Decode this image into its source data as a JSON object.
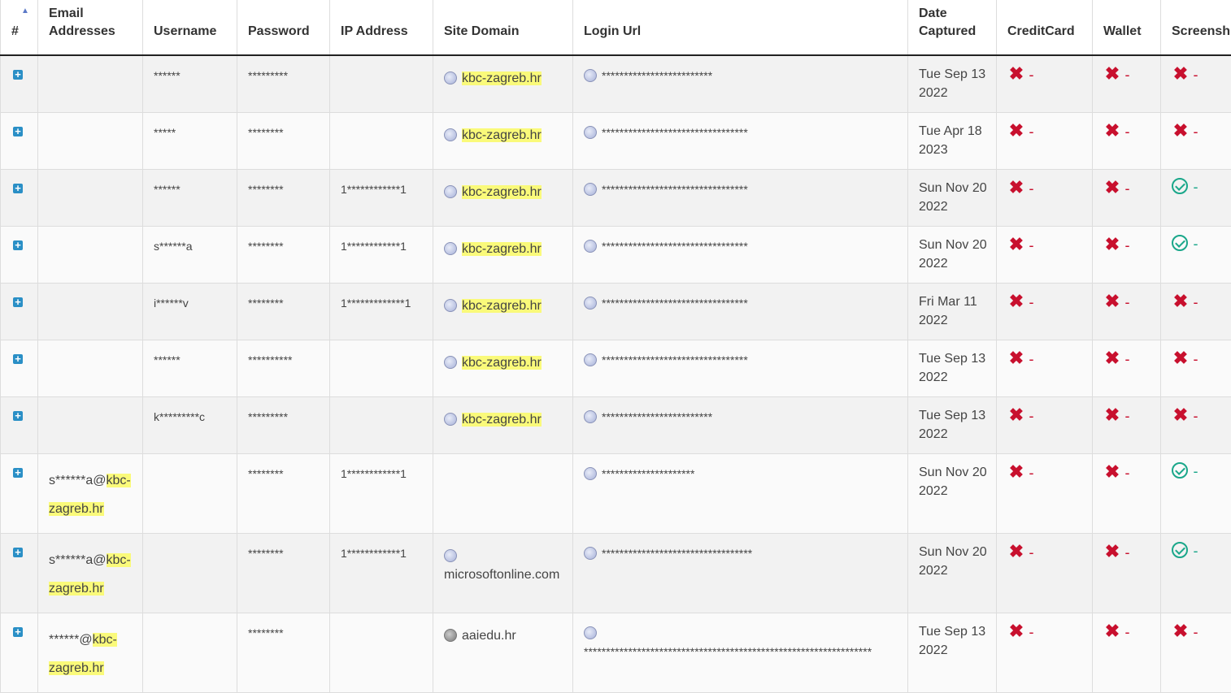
{
  "columns": {
    "index": "#",
    "email": "Email Addresses",
    "username": "Username",
    "password": "Password",
    "ip": "IP Address",
    "domain": "Site Domain",
    "login_url": "Login Url",
    "date": "Date Captured",
    "creditcard": "CreditCard",
    "wallet": "Wallet",
    "screenshot": "Screensh"
  },
  "dash": "-",
  "rows": [
    {
      "email_user": "",
      "email_domain": "",
      "username": "******",
      "password": "*********",
      "ip": "",
      "domain": "kbc-zagreb.hr",
      "login_url": "*************************",
      "date": "Tue Sep 13 2022",
      "screenshot": false
    },
    {
      "email_user": "",
      "email_domain": "",
      "username": "*****",
      "password": "********",
      "ip": "",
      "domain": "kbc-zagreb.hr",
      "login_url": "*********************************",
      "date": "Tue Apr 18 2023",
      "screenshot": false
    },
    {
      "email_user": "",
      "email_domain": "",
      "username": "******",
      "password": "********",
      "ip": "1************1",
      "domain": "kbc-zagreb.hr",
      "login_url": "*********************************",
      "date": "Sun Nov 20 2022",
      "screenshot": true
    },
    {
      "email_user": "",
      "email_domain": "",
      "username": "s******a",
      "password": "********",
      "ip": "1************1",
      "domain": "kbc-zagreb.hr",
      "login_url": "*********************************",
      "date": "Sun Nov 20 2022",
      "screenshot": true
    },
    {
      "email_user": "",
      "email_domain": "",
      "username": "i******v",
      "password": "********",
      "ip": "1*************1",
      "domain": "kbc-zagreb.hr",
      "login_url": "*********************************",
      "date": "Fri Mar 11 2022",
      "screenshot": false
    },
    {
      "email_user": "",
      "email_domain": "",
      "username": "******",
      "password": "**********",
      "ip": "",
      "domain": "kbc-zagreb.hr",
      "login_url": "*********************************",
      "date": "Tue Sep 13 2022",
      "screenshot": false
    },
    {
      "email_user": "",
      "email_domain": "",
      "username": "k*********c",
      "password": "*********",
      "ip": "",
      "domain": "kbc-zagreb.hr",
      "login_url": "*************************",
      "date": "Tue Sep 13 2022",
      "screenshot": false
    },
    {
      "email_user": "s******a@",
      "email_domain": "kbc-zagreb.hr",
      "username": "",
      "password": "********",
      "ip": "1************1",
      "domain": "",
      "login_url": "*********************",
      "date": "Sun Nov 20 2022",
      "screenshot": true
    },
    {
      "email_user": "s******a@",
      "email_domain": "kbc-zagreb.hr",
      "username": "",
      "password": "********",
      "ip": "1************1",
      "domain": "microsoftonline.com",
      "login_url": "**********************************",
      "date": "Sun Nov 20 2022",
      "screenshot": true
    },
    {
      "email_user": "******@",
      "email_domain": "kbc-zagreb.hr",
      "username": "",
      "password": "********",
      "ip": "",
      "domain": "aaiedu.hr",
      "login_url": "*****************************************************************",
      "date": "Tue Sep 13 2022",
      "screenshot": false
    }
  ],
  "colors": {
    "accent": "#2a8fc6",
    "error": "#c8102e",
    "success": "#1aa78a",
    "highlight": "#fafa7a"
  }
}
